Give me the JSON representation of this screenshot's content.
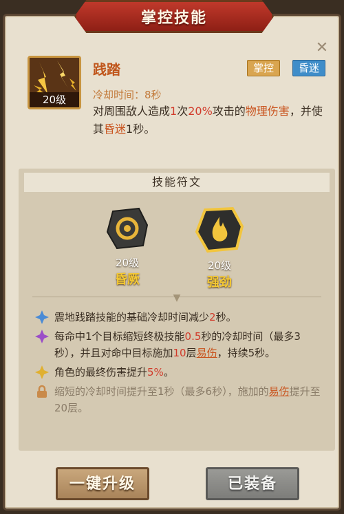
{
  "window": {
    "title": "掌控技能"
  },
  "skill": {
    "name": "践踏",
    "level": "20级",
    "tags": [
      "掌控",
      "昏迷"
    ],
    "cooldown": "冷却时间：8秒",
    "description": {
      "p1": "对周围敌人造成",
      "hits": "1",
      "p2": "次",
      "pct": "20%",
      "p3": "攻击的",
      "dmg": "物理伤害",
      "p4": "，并使其",
      "stun": "昏迷",
      "stun_time": "1",
      "p5": "秒。"
    }
  },
  "runes": {
    "header": "技能符文",
    "items": [
      {
        "level": "20级",
        "name": "昏厥",
        "icon": "swirl-icon"
      },
      {
        "level": "20级",
        "name": "强劲",
        "icon": "flame-icon"
      }
    ]
  },
  "effects": [
    {
      "icon": "blue-star-icon",
      "a": "震地践踏技能的基础冷却时间减少",
      "b": "2",
      "c": "秒。"
    },
    {
      "icon": "purple-star-icon",
      "a": "每命中1个目标缩短终极技能",
      "b": "0.5",
      "c": "秒的冷却时间（最多3秒），并且对命中目标施加",
      "d": "10",
      "e": "层",
      "f": "易伤",
      "g": "，持续5秒。"
    },
    {
      "icon": "gold-star-icon",
      "a": "角色的最终伤害提升",
      "b": "5%",
      "c": "。"
    },
    {
      "icon": "lock-icon",
      "a": "缩短的冷却时间提升至1秒（最多6秒），施加的",
      "f": "易伤",
      "g": "提升至20层。"
    }
  ],
  "buttons": {
    "upgrade": "一键升级",
    "equipped": "已装备"
  },
  "colors": {
    "accent_red": "#d13a2a",
    "accent_orange": "#c9521c",
    "rune_name": "#f3c833"
  }
}
